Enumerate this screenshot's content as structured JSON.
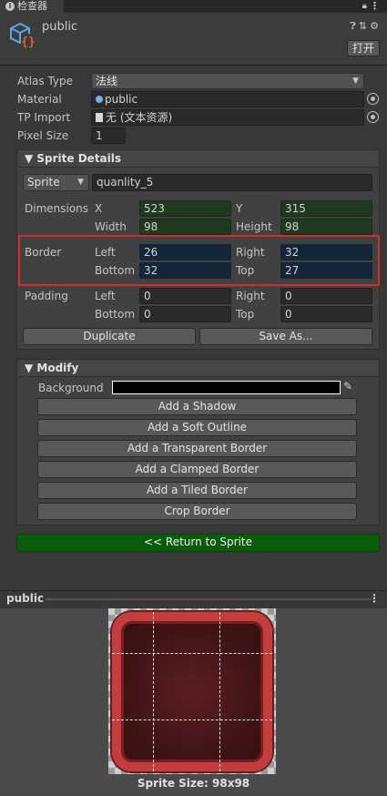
{
  "window": {
    "tab_label": "检查器",
    "tab_icon": "info-icon"
  },
  "header": {
    "title": "public",
    "icon": "cube-script-icon",
    "open_button": "打开",
    "icons": [
      "help-icon",
      "settings-sliders-icon",
      "gear-icon"
    ]
  },
  "properties": {
    "atlas_type": {
      "label": "Atlas Type",
      "value": "法线"
    },
    "material": {
      "label": "Material",
      "value": "public"
    },
    "tp_import": {
      "label": "TP Import",
      "value": "无 (文本资源)"
    },
    "pixel_size": {
      "label": "Pixel Size",
      "value": "1"
    }
  },
  "sprite_details": {
    "title": "Sprite Details",
    "sprite_dropdown": "Sprite",
    "sprite_name": "quanlity_5",
    "dimensions": {
      "label": "Dimensions",
      "x_label": "X",
      "x": "523",
      "y_label": "Y",
      "y": "315",
      "width_label": "Width",
      "width": "98",
      "height_label": "Height",
      "height": "98"
    },
    "border": {
      "label": "Border",
      "left_label": "Left",
      "left": "26",
      "right_label": "Right",
      "right": "32",
      "bottom_label": "Bottom",
      "bottom": "32",
      "top_label": "Top",
      "top": "27"
    },
    "padding": {
      "label": "Padding",
      "left_label": "Left",
      "left": "0",
      "right_label": "Right",
      "right": "0",
      "bottom_label": "Bottom",
      "bottom": "0",
      "top_label": "Top",
      "top": "0"
    },
    "duplicate_button": "Duplicate",
    "save_as_button": "Save As..."
  },
  "modify": {
    "title": "Modify",
    "background_label": "Background",
    "buttons": [
      "Add a Shadow",
      "Add a Soft Outline",
      "Add a Transparent Border",
      "Add a Clamped Border",
      "Add a Tiled Border",
      "Crop Border"
    ]
  },
  "return_button": "<< Return to Sprite",
  "preview": {
    "title": "public",
    "caption": "Sprite Size: 98x98"
  },
  "colors": {
    "accent_green": "#0a5c0a",
    "border_highlight": "#d22c2c",
    "sprite_red": "#c23e3d"
  }
}
